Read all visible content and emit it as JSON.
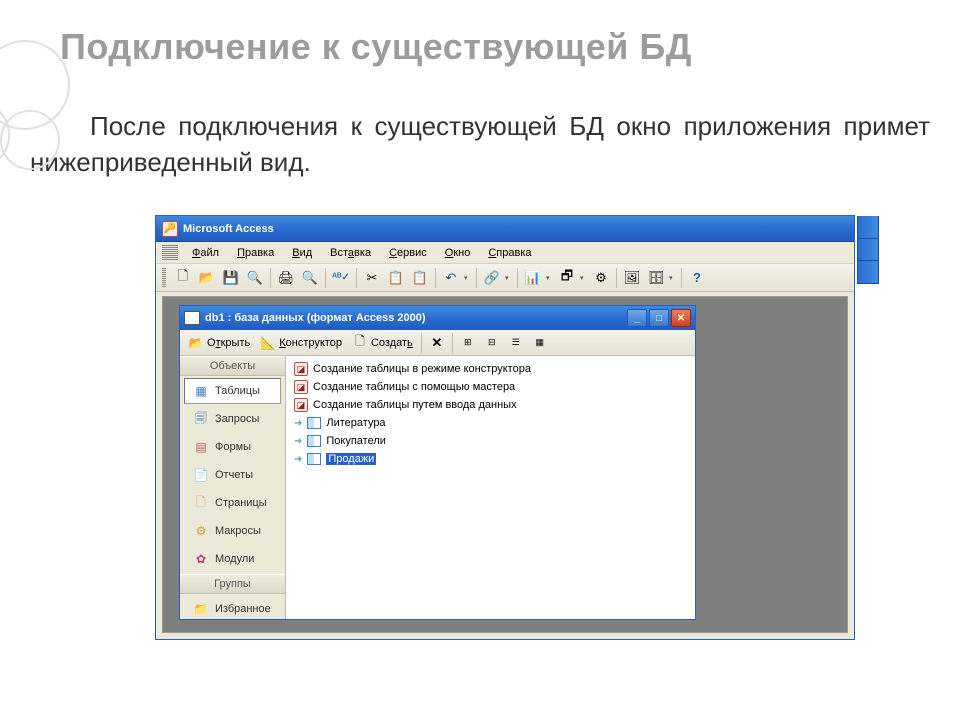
{
  "slide": {
    "title": "Подключение к существующей БД",
    "body": "После подключения к существующей БД окно приложения примет нижеприведенный вид."
  },
  "app": {
    "title": "Microsoft Access",
    "menu": {
      "file": "Файл",
      "edit": "Правка",
      "view": "Вид",
      "insert": "Вставка",
      "tools": "Сервис",
      "window": "Окно",
      "help": "Справка"
    }
  },
  "child": {
    "title": "db1 : база данных (формат Access 2000)",
    "toolbar": {
      "open": "Открыть",
      "design": "Конструктор",
      "new": "Создать"
    },
    "nav": {
      "objects_head": "Объекты",
      "items": [
        {
          "label": "Таблицы",
          "icon": "▦"
        },
        {
          "label": "Запросы",
          "icon": "🗐"
        },
        {
          "label": "Формы",
          "icon": "▤"
        },
        {
          "label": "Отчеты",
          "icon": "📄"
        },
        {
          "label": "Страницы",
          "icon": "🗋"
        },
        {
          "label": "Макросы",
          "icon": "⚙"
        },
        {
          "label": "Модули",
          "icon": "✿"
        }
      ],
      "groups_head": "Группы",
      "favorites": "Избранное"
    },
    "list": {
      "wizards": [
        "Создание таблицы в режиме конструктора",
        "Создание таблицы с помощью мастера",
        "Создание таблицы путем ввода данных"
      ],
      "tables": [
        "Литература",
        "Покупатели",
        "Продажи"
      ],
      "selected": "Продажи"
    }
  }
}
